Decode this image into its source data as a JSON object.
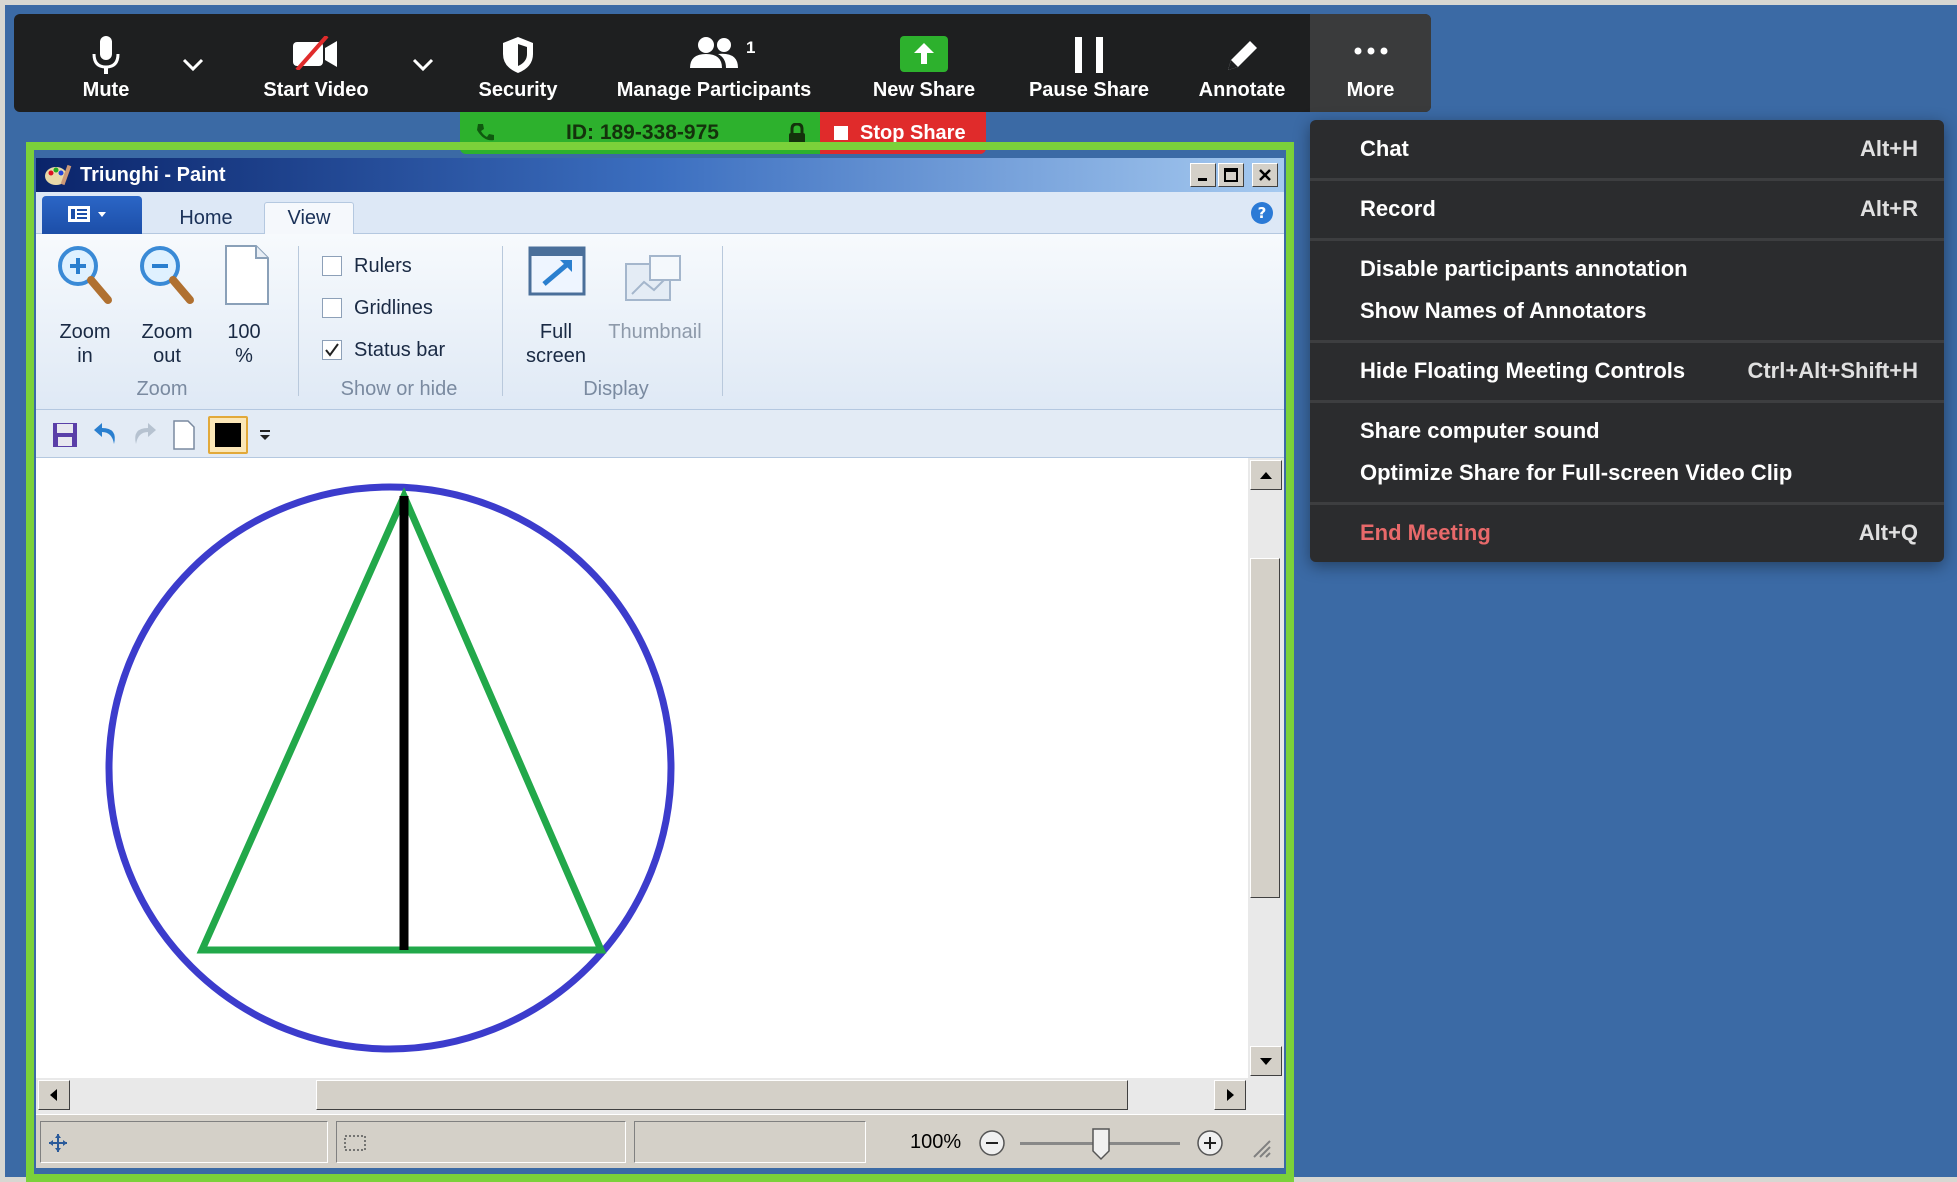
{
  "toolbar": {
    "mute": "Mute",
    "start_video": "Start Video",
    "security": "Security",
    "manage_participants": "Manage Participants",
    "participant_count": "1",
    "new_share": "New Share",
    "pause_share": "Pause Share",
    "annotate": "Annotate",
    "more": "More"
  },
  "meeting_bar": {
    "id": "ID: 189-338-975",
    "stop_share": "Stop Share"
  },
  "paint": {
    "title": "Triunghi - Paint",
    "tabs": [
      "Home",
      "View"
    ],
    "ribbon": {
      "zoom_in": [
        "Zoom",
        "in"
      ],
      "zoom_out": [
        "Zoom",
        "out"
      ],
      "hundred": [
        "100",
        "%"
      ],
      "group_zoom": "Zoom",
      "rulers": "Rulers",
      "gridlines": "Gridlines",
      "statusbar": "Status bar",
      "statusbar_checked": true,
      "group_show": "Show or hide",
      "fullscreen": [
        "Full",
        "screen"
      ],
      "thumbnail": "Thumbnail",
      "group_display": "Display"
    },
    "status": {
      "zoom": "100%"
    },
    "colors": {
      "circle": "#3c3ccc",
      "triangle": "#22a84a",
      "line": "#000000"
    }
  },
  "more_menu": {
    "items": [
      {
        "label": "Chat",
        "shortcut": "Alt+H"
      },
      {
        "label": "Record",
        "shortcut": "Alt+R"
      },
      {
        "label": "Disable participants annotation",
        "shortcut": ""
      },
      {
        "label": "Show Names of Annotators",
        "shortcut": ""
      },
      {
        "label": "Hide Floating Meeting Controls",
        "shortcut": "Ctrl+Alt+Shift+H"
      },
      {
        "label": "Share computer sound",
        "shortcut": ""
      },
      {
        "label": "Optimize Share for Full-screen Video Clip",
        "shortcut": ""
      },
      {
        "label": "End Meeting",
        "shortcut": "Alt+Q"
      }
    ],
    "end_color": "#e8696a"
  }
}
